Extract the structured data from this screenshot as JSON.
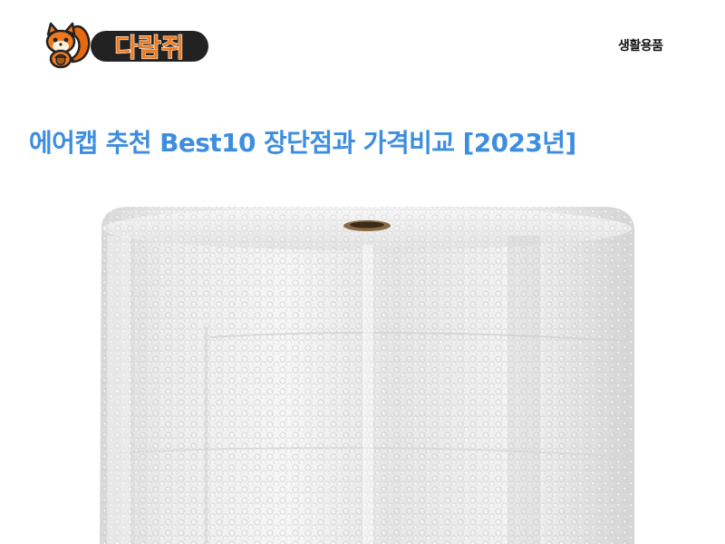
{
  "site": {
    "logo_text": "다람쥐",
    "nav_link": "생활용품"
  },
  "post": {
    "title": "에어캡 추천 Best10 장단점과 가격비교 [2023년]"
  },
  "colors": {
    "title_blue": "#3e8ee0",
    "logo_orange": "#f07a1e",
    "logo_dark": "#222222"
  },
  "icons": {
    "logo": "squirrel-mascot-icon",
    "hero": "bubble-wrap-roll-image"
  }
}
